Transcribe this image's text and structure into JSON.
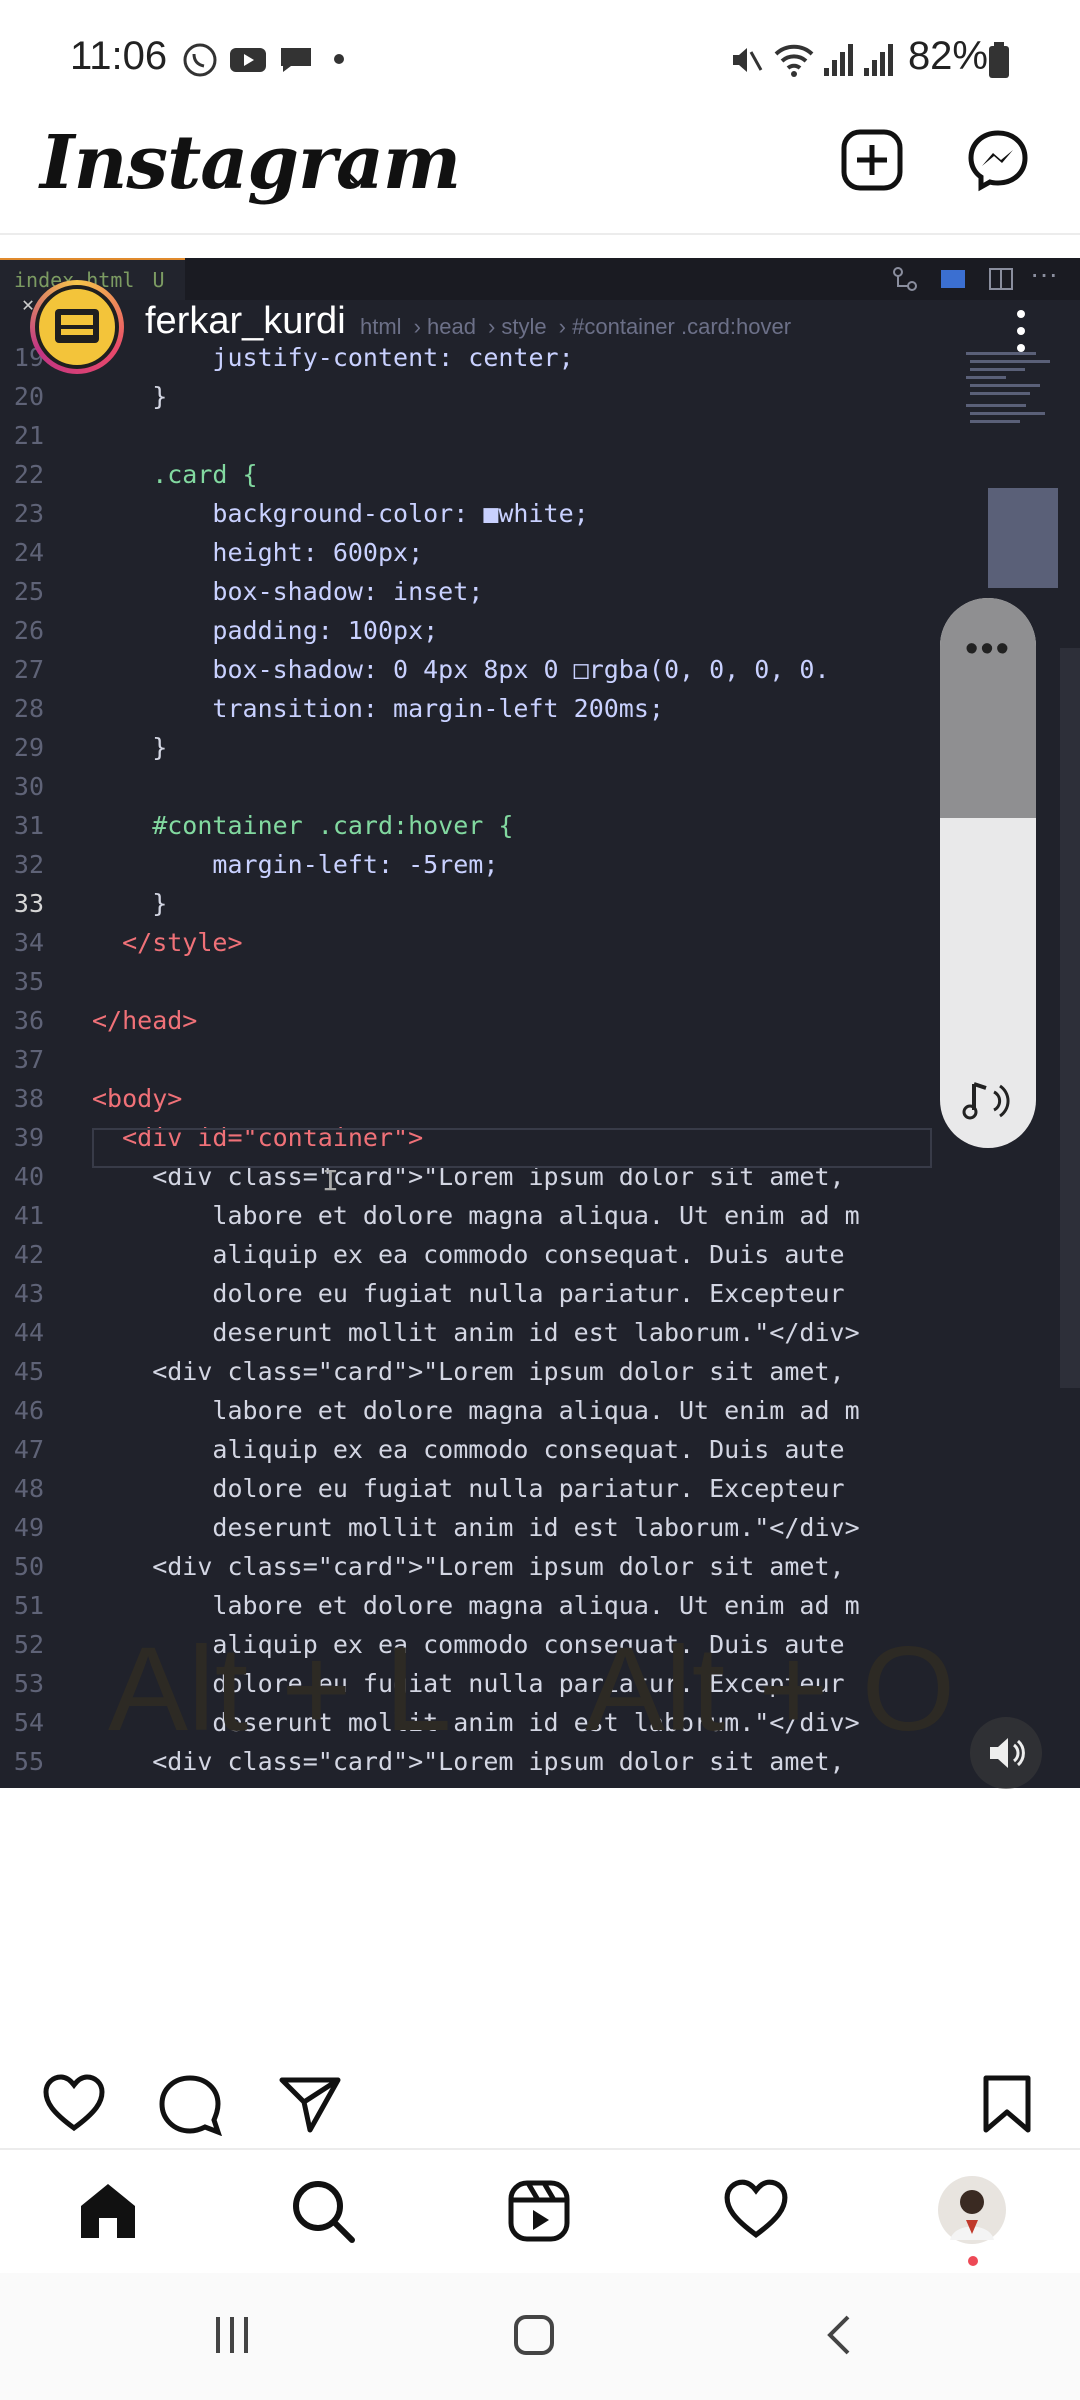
{
  "status_bar": {
    "time": "11:06",
    "battery": "82%"
  },
  "ig_header": {
    "logo": "Instagram"
  },
  "post": {
    "username": "ferkar_kurdi",
    "caption_shortcuts": [
      "Alt + L",
      "Alt + O"
    ]
  },
  "editor": {
    "tab_filename": "index.html",
    "tab_status": "U",
    "breadcrumb": [
      "html",
      "head",
      "style",
      "#container .card:hover"
    ],
    "lines": [
      {
        "n": "19",
        "code": "        justify-content: center;"
      },
      {
        "n": "20",
        "code": "    }"
      },
      {
        "n": "21",
        "code": ""
      },
      {
        "n": "22",
        "code": "    .card {"
      },
      {
        "n": "23",
        "code": "        background-color: ■white;"
      },
      {
        "n": "24",
        "code": "        height: 600px;"
      },
      {
        "n": "25",
        "code": "        box-shadow: inset;"
      },
      {
        "n": "26",
        "code": "        padding: 100px;"
      },
      {
        "n": "27",
        "code": "        box-shadow: 0 4px 8px 0 □rgba(0, 0, 0, 0."
      },
      {
        "n": "28",
        "code": "        transition: margin-left 200ms;"
      },
      {
        "n": "29",
        "code": "    }"
      },
      {
        "n": "30",
        "code": ""
      },
      {
        "n": "31",
        "code": "    #container .card:hover {"
      },
      {
        "n": "32",
        "code": "        margin-left: -5rem;"
      },
      {
        "n": "33",
        "code": "    }"
      },
      {
        "n": "34",
        "code": "  </style>"
      },
      {
        "n": "35",
        "code": ""
      },
      {
        "n": "36",
        "code": "</head>"
      },
      {
        "n": "37",
        "code": ""
      },
      {
        "n": "38",
        "code": "<body>"
      },
      {
        "n": "39",
        "code": "  <div id=\"container\">"
      },
      {
        "n": "40",
        "code": "    <div class=\"card\">\"Lorem ipsum dolor sit amet,"
      },
      {
        "n": "41",
        "code": "        labore et dolore magna aliqua. Ut enim ad m"
      },
      {
        "n": "42",
        "code": "        aliquip ex ea commodo consequat. Duis aute"
      },
      {
        "n": "43",
        "code": "        dolore eu fugiat nulla pariatur. Excepteur"
      },
      {
        "n": "44",
        "code": "        deserunt mollit anim id est laborum.\"</div>"
      },
      {
        "n": "45",
        "code": "    <div class=\"card\">\"Lorem ipsum dolor sit amet,"
      },
      {
        "n": "46",
        "code": "        labore et dolore magna aliqua. Ut enim ad m"
      },
      {
        "n": "47",
        "code": "        aliquip ex ea commodo consequat. Duis aute"
      },
      {
        "n": "48",
        "code": "        dolore eu fugiat nulla pariatur. Excepteur"
      },
      {
        "n": "49",
        "code": "        deserunt mollit anim id est laborum.\"</div>"
      },
      {
        "n": "50",
        "code": "    <div class=\"card\">\"Lorem ipsum dolor sit amet,"
      },
      {
        "n": "51",
        "code": "        labore et dolore magna aliqua. Ut enim ad m"
      },
      {
        "n": "52",
        "code": "        aliquip ex ea commodo consequat. Duis aute"
      },
      {
        "n": "53",
        "code": "        dolore eu fugiat nulla pariatur. Excepteur"
      },
      {
        "n": "54",
        "code": "        deserunt mollit anim id est laborum.\"</div>"
      },
      {
        "n": "55",
        "code": "    <div class=\"card\">\"Lorem ipsum dolor sit amet,"
      }
    ],
    "current_line": "33"
  },
  "volume": {
    "level": 0.6
  },
  "icons": {
    "status_left": [
      "viber-icon",
      "youtube-icon",
      "chat-icon",
      "dot-icon"
    ],
    "status_right": [
      "mute-icon",
      "wifi-icon",
      "signal-icon",
      "signal-icon",
      "battery-icon"
    ],
    "actions": [
      "heart-icon",
      "comment-icon",
      "send-icon",
      "bookmark-icon"
    ],
    "bottom_nav": [
      "home-icon",
      "search-icon",
      "reels-icon",
      "heart-icon",
      "avatar"
    ]
  },
  "colors": {
    "accent_band": "#b69b3a",
    "editor_bg": "#20222b",
    "notification_dot": "#ed4956"
  }
}
